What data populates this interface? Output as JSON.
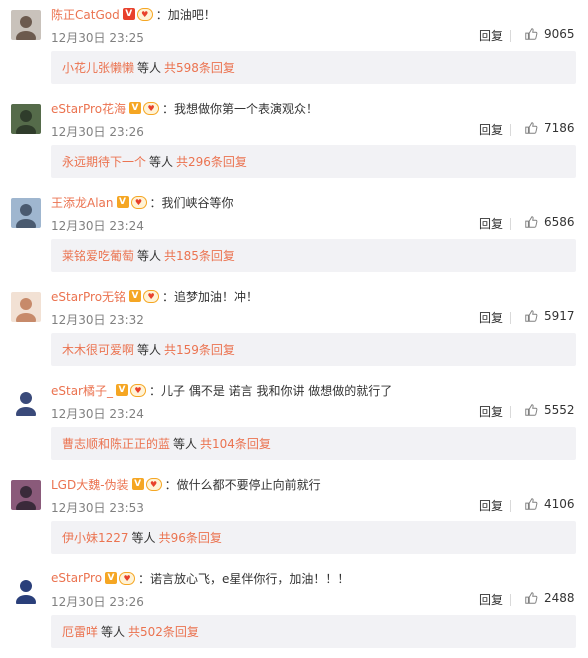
{
  "like_label_icon": "thumbs-up-icon",
  "reply_label": "回复",
  "comments": [
    {
      "user": "陈正CatGod",
      "badge": "V",
      "badge_color": "#e8412c",
      "text": "：加油吧！",
      "time": "12月30日 23:25",
      "likes": "9065",
      "reply_names": "小花儿张懒懒",
      "reply_mid": "等人",
      "reply_count": "共598条回复",
      "avatar_colors": [
        "#c9c2bb",
        "#6c5a4e"
      ]
    },
    {
      "user": "eStarPro花海",
      "badge": "V",
      "badge_color": "#f5a623",
      "text": "：我想做你第一个表演观众！",
      "time": "12月30日 23:26",
      "likes": "7186",
      "reply_names": "永远期待下一个",
      "reply_mid": "等人",
      "reply_count": "共296条回复",
      "avatar_colors": [
        "#556b4a",
        "#2f3c2b"
      ]
    },
    {
      "user": "王添龙Alan",
      "badge": "V",
      "badge_color": "#f5a623",
      "text": "：我们峡谷等你",
      "time": "12月30日 23:24",
      "likes": "6586",
      "reply_names": "莱铭爱吃葡萄",
      "reply_mid": "等人",
      "reply_count": "共185条回复",
      "avatar_colors": [
        "#9fb6cf",
        "#4a5a6f"
      ]
    },
    {
      "user": "eStarPro无铭",
      "badge": "V",
      "badge_color": "#f5a623",
      "text": "：追梦加油！冲！",
      "time": "12月30日 23:32",
      "likes": "5917",
      "reply_names": "木木很可爱啊",
      "reply_mid": "等人",
      "reply_count": "共159条回复",
      "avatar_colors": [
        "#f2e1d4",
        "#c78a6a"
      ]
    },
    {
      "user": "eStar橘子_",
      "badge": "V",
      "badge_color": "#f5a623",
      "text": "：儿子 偶不是 诺言 我和你讲  做想做的就行了",
      "time": "12月30日 23:24",
      "likes": "5552",
      "reply_names": "曹志顺和陈正正的蓝",
      "reply_mid": "等人",
      "reply_count": "共104条回复",
      "avatar_colors": [
        "#ffffff",
        "#3a4a7a"
      ]
    },
    {
      "user": "LGD大魏-伪装",
      "badge": "V",
      "badge_color": "#f5a623",
      "text": "：做什么都不要停止向前就行",
      "time": "12月30日 23:53",
      "likes": "4106",
      "reply_names": "伊小妹1227",
      "reply_mid": "等人",
      "reply_count": "共96条回复",
      "avatar_colors": [
        "#8a5a7a",
        "#3a2a3a"
      ]
    },
    {
      "user": "eStarPro",
      "badge": "V",
      "badge_color": "#f5a623",
      "text": "：诺言放心飞，e星伴你行，加油！！！",
      "time": "12月30日 23:26",
      "likes": "2488",
      "reply_names": "厄雷咩",
      "reply_mid": "等人",
      "reply_count": "共502条回复",
      "avatar_colors": [
        "#ffffff",
        "#2a3f7a"
      ]
    }
  ]
}
